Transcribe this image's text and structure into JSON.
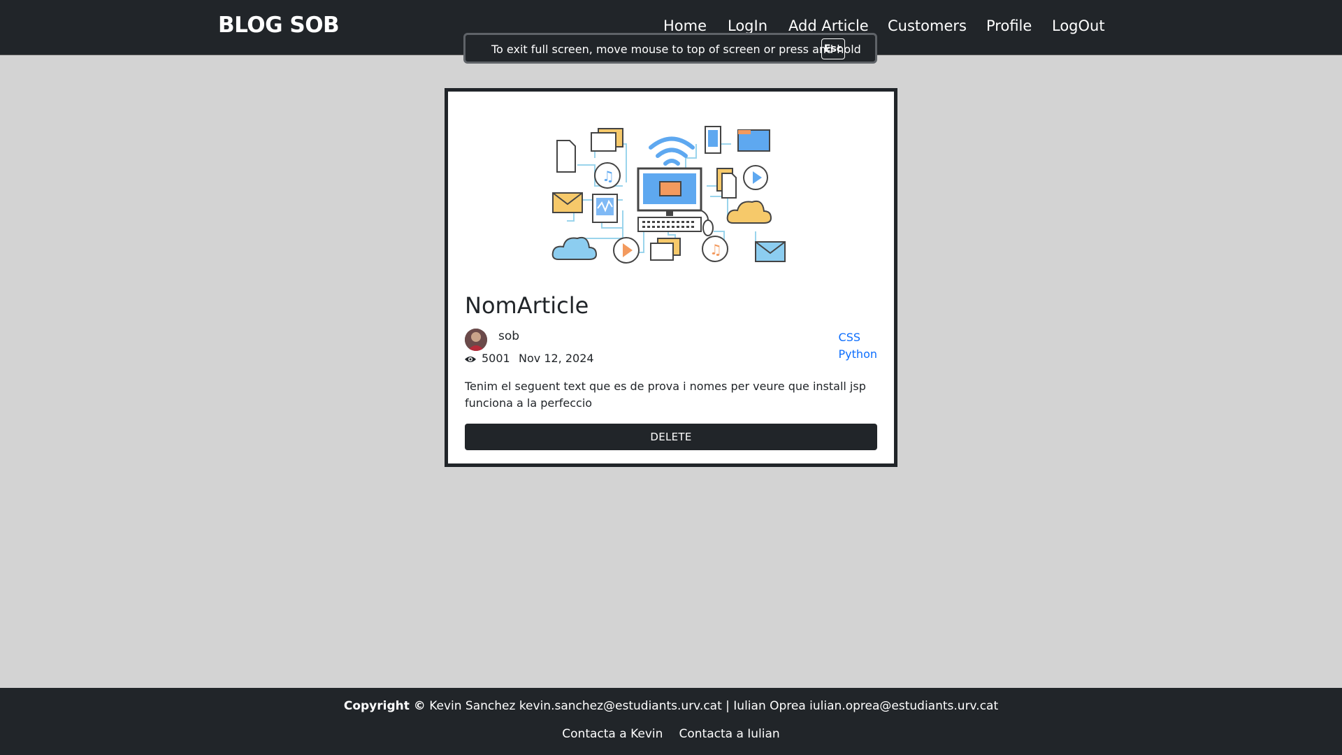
{
  "brand": "BLOG SOB",
  "nav": {
    "items": [
      "Home",
      "LogIn",
      "Add Article",
      "Customers",
      "Profile",
      "LogOut"
    ]
  },
  "fullscreen_toast": {
    "message": "To exit full screen, move mouse to top of screen or press and hold",
    "key": "Esc"
  },
  "article": {
    "title": "NomArticle",
    "author": "sob",
    "views": "5001",
    "date": "Nov 12, 2024",
    "tags": [
      "CSS",
      "Python"
    ],
    "description": "Tenim el seguent text que es de prova i nomes per veure que install jsp funciona a la perfeccio",
    "delete_label": "DELETE"
  },
  "footer": {
    "copyright_label": "Copyright ©",
    "copyright_text": " Kevin Sanchez kevin.sanchez@estudiants.urv.cat | Iulian Oprea iulian.oprea@estudiants.urv.cat",
    "links": [
      "Contacta a Kevin",
      "Contacta a Iulian"
    ]
  },
  "colors": {
    "navbar": "#212529",
    "background": "#d3d3d3",
    "link": "#0d6efd"
  }
}
